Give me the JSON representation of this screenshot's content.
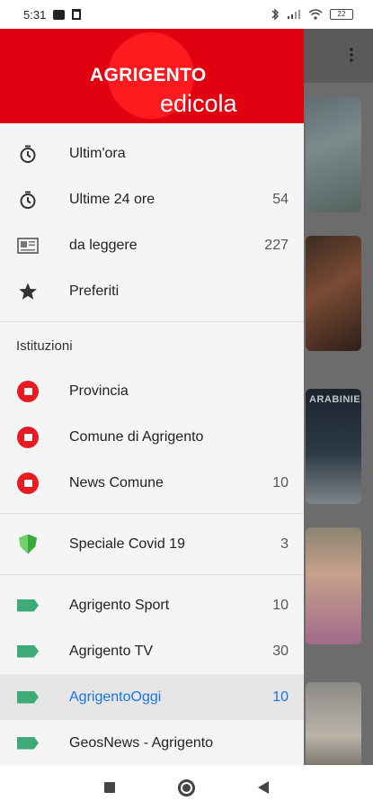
{
  "status_bar": {
    "time": "5:31",
    "battery": "22"
  },
  "header": {
    "brand_title": "AGRIGENTO",
    "brand_subtitle": "edicola"
  },
  "menu": {
    "items": [
      {
        "label": "Ultim'ora",
        "count": ""
      },
      {
        "label": "Ultime 24 ore",
        "count": "54"
      },
      {
        "label": "da leggere",
        "count": "227"
      },
      {
        "label": "Preferiti",
        "count": ""
      }
    ]
  },
  "istituzioni": {
    "title": "Istituzioni",
    "items": [
      {
        "label": "Provincia",
        "count": ""
      },
      {
        "label": "Comune di Agrigento",
        "count": ""
      },
      {
        "label": "News Comune",
        "count": "10"
      }
    ]
  },
  "covid": {
    "label": "Speciale Covid 19",
    "count": "3"
  },
  "sources": {
    "items": [
      {
        "label": "Agrigento Sport",
        "count": "10"
      },
      {
        "label": "Agrigento TV",
        "count": "30"
      },
      {
        "label": "AgrigentoOggi",
        "count": "10"
      },
      {
        "label": "GeosNews - Agrigento",
        "count": ""
      }
    ]
  },
  "background_app": {
    "thumb_caption": "ARABINIE"
  },
  "colors": {
    "brand_red": "#e00010",
    "selected_text": "#1a73e8",
    "tag_green": "#3daa77"
  }
}
